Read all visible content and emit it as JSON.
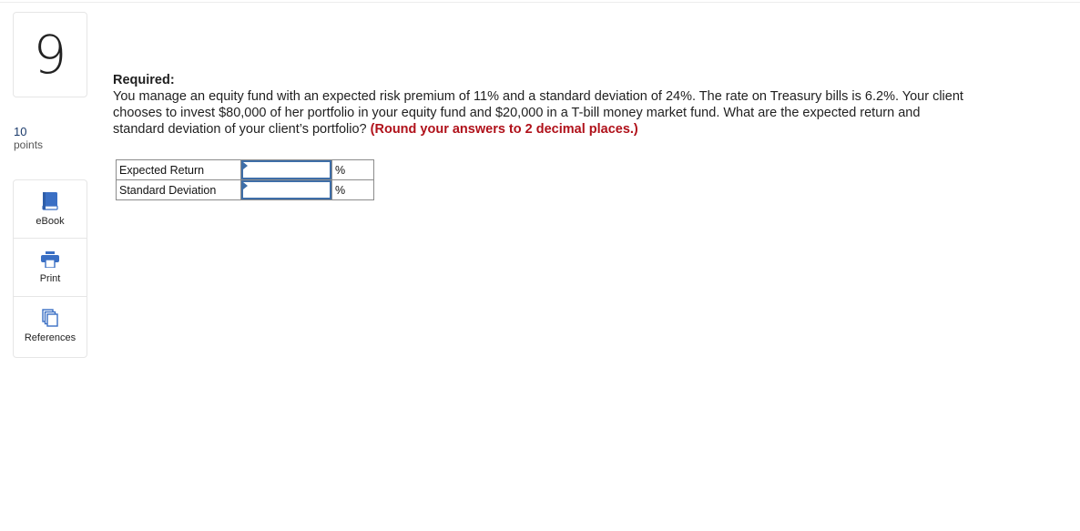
{
  "question": {
    "number": "9",
    "points_value": "10",
    "points_label": "points"
  },
  "tools": [
    {
      "label": "eBook",
      "icon": "book-icon"
    },
    {
      "label": "Print",
      "icon": "printer-icon"
    },
    {
      "label": "References",
      "icon": "documents-icon"
    }
  ],
  "content": {
    "required_label": "Required:",
    "prompt": "You manage an equity fund with an expected risk premium of 11% and a standard deviation of 24%. The rate on Treasury bills is 6.2%. Your client chooses to invest $80,000 of her portfolio in your equity fund and $20,000 in a T-bill money market fund. What are the expected return and standard deviation of your client’s portfolio? ",
    "instruction": "(Round your answers to 2 decimal places.)"
  },
  "answers": [
    {
      "label": "Expected Return",
      "value": "",
      "unit": "%"
    },
    {
      "label": "Standard Deviation",
      "value": "",
      "unit": "%"
    }
  ],
  "colors": {
    "accent": "#3e6ea8",
    "instruction": "#b0111a",
    "icon": "#3a6fc4"
  }
}
